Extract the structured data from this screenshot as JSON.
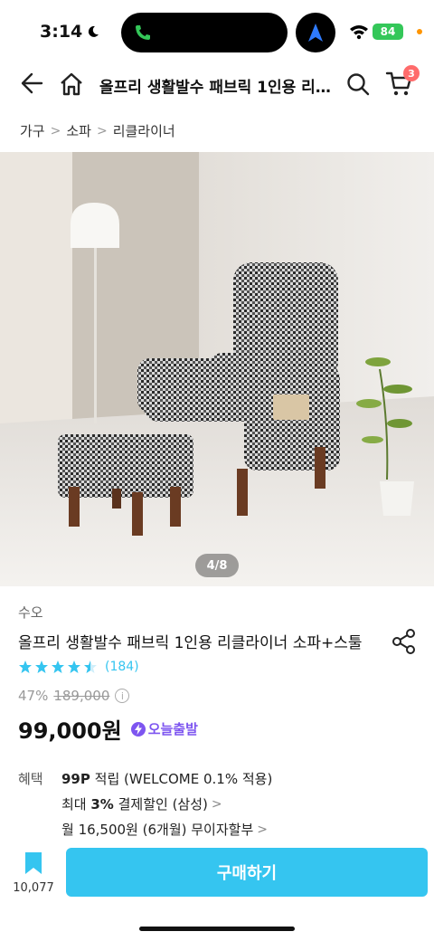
{
  "status": {
    "time": "3:14",
    "battery": "84"
  },
  "header": {
    "title": "올프리 생활발수 패브릭 1인용 리…",
    "cart_count": "3"
  },
  "breadcrumb": [
    "가구",
    "소파",
    "리클라이너"
  ],
  "gallery": {
    "counter": "4/8"
  },
  "product": {
    "brand": "수오",
    "name": "올프리 생활발수 패브릭 1인용 리클라이너 소파+스툴",
    "rating": 4.5,
    "review_count": "(184)",
    "discount": "47%",
    "original_price": "189,000",
    "price": "99,000원",
    "today_delivery": "오늘출발"
  },
  "benefits": {
    "label": "혜택",
    "items": [
      {
        "strong": "99P",
        "text": " 적립 (WELCOME 0.1% 적용)"
      },
      {
        "prefix": "최대 ",
        "strong": "3%",
        "text": " 결제할인 (삼성)"
      },
      {
        "text": "월 16,500원 (6개월) 무이자할부"
      }
    ]
  },
  "bottom": {
    "bookmark_count": "10,077",
    "buy_label": "구매하기"
  },
  "colors": {
    "accent": "#35c5f0",
    "purple": "#7d55f0",
    "badge": "#ff6b6b"
  },
  "icons": [
    "back-icon",
    "home-icon",
    "search-icon",
    "cart-icon",
    "share-icon",
    "star-icon",
    "info-icon",
    "bolt-icon",
    "bookmark-icon"
  ]
}
